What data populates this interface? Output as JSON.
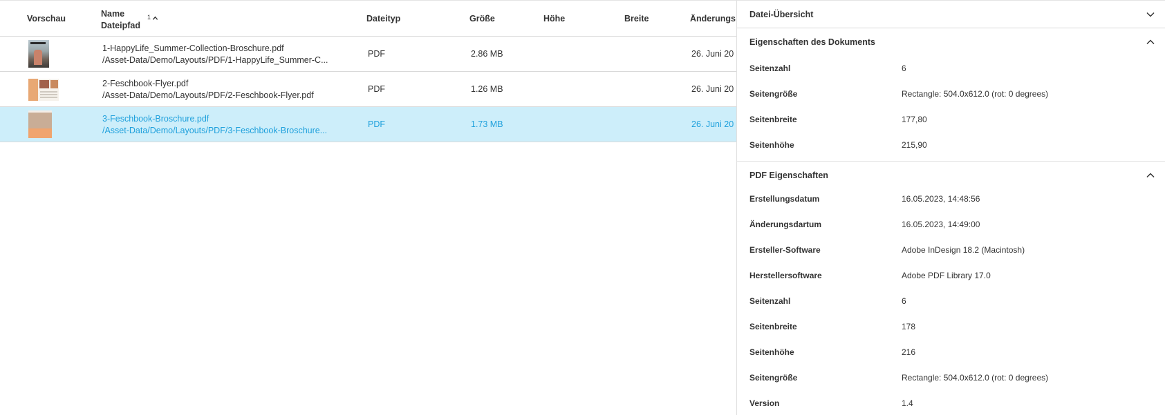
{
  "table": {
    "columns": {
      "preview": "Vorschau",
      "name": "Name",
      "path": "Dateipfad",
      "sort_number": "1",
      "type": "Dateityp",
      "size": "Größe",
      "height": "Höhe",
      "width": "Breite",
      "changed": "Änderungs"
    },
    "rows": [
      {
        "name": "1-HappyLife_Summer-Collection-Broschure.pdf",
        "path": "/Asset-Data/Demo/Layouts/PDF/1-HappyLife_Summer-C...",
        "type": "PDF",
        "size": "2.86 MB",
        "date": "26. Juni 20",
        "selected": false
      },
      {
        "name": "2-Feschbook-Flyer.pdf",
        "path": "/Asset-Data/Demo/Layouts/PDF/2-Feschbook-Flyer.pdf",
        "type": "PDF",
        "size": "1.26 MB",
        "date": "26. Juni 20",
        "selected": false
      },
      {
        "name": "3-Feschbook-Broschure.pdf",
        "path": "/Asset-Data/Demo/Layouts/PDF/3-Feschbook-Broschure...",
        "type": "PDF",
        "size": "1.73 MB",
        "date": "26. Juni 20",
        "selected": true
      }
    ]
  },
  "panel": {
    "overview_title": "Datei-Übersicht",
    "document_section": {
      "title": "Eigenschaften des Dokuments",
      "props": [
        {
          "label": "Seitenzahl",
          "value": "6"
        },
        {
          "label": "Seitengröße",
          "value": "Rectangle: 504.0x612.0 (rot: 0 degrees)"
        },
        {
          "label": "Seitenbreite",
          "value": "177,80"
        },
        {
          "label": "Seitenhöhe",
          "value": "215,90"
        }
      ]
    },
    "pdf_section": {
      "title": "PDF Eigenschaften",
      "props": [
        {
          "label": "Erstellungsdatum",
          "value": "16.05.2023, 14:48:56"
        },
        {
          "label": "Änderungsdartum",
          "value": "16.05.2023, 14:49:00"
        },
        {
          "label": "Ersteller-Software",
          "value": "Adobe InDesign 18.2 (Macintosh)"
        },
        {
          "label": "Herstellersoftware",
          "value": "Adobe PDF Library 17.0"
        },
        {
          "label": "Seitenzahl",
          "value": "6"
        },
        {
          "label": "Seitenbreite",
          "value": "178"
        },
        {
          "label": "Seitenhöhe",
          "value": "216"
        },
        {
          "label": "Seitengröße",
          "value": "Rectangle: 504.0x612.0 (rot: 0 degrees)"
        },
        {
          "label": "Version",
          "value": "1.4"
        }
      ]
    }
  }
}
